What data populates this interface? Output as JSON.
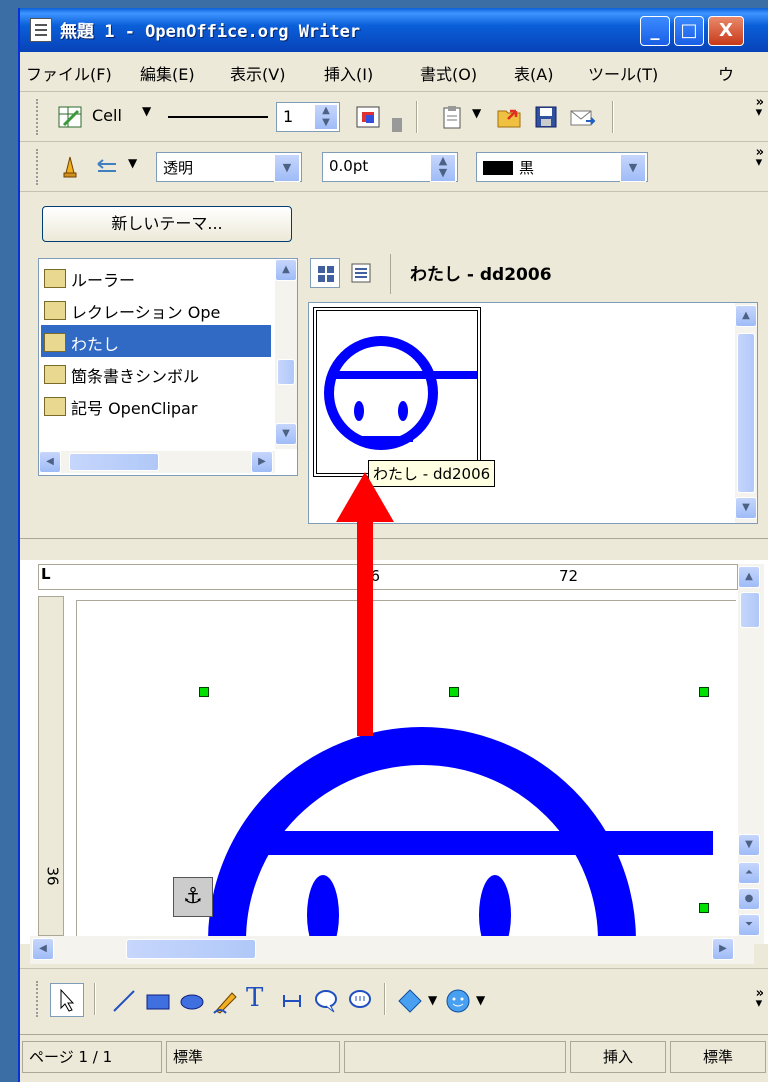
{
  "window": {
    "title": "無題 1 - OpenOffice.org Writer",
    "controls": [
      "_",
      "□",
      "X"
    ]
  },
  "menubar": {
    "items": [
      "ファイル(F)",
      "編集(E)",
      "表示(V)",
      "挿入(I)",
      "書式(O)",
      "表(A)",
      "ツール(T)",
      "ウ"
    ]
  },
  "toolbar1": {
    "cell_label": "Cell",
    "line_width": "1",
    "icons": [
      "table-icon",
      "line-style-icon",
      "color-icon",
      "clipboard-icon",
      "open-folder-icon",
      "save-icon",
      "mail-icon"
    ]
  },
  "toolbar2": {
    "fill_value": "透明",
    "size_value": "0.0pt",
    "color_value": "黒",
    "icons": [
      "pen-icon",
      "arrow-icon"
    ]
  },
  "gallery": {
    "new_theme_button": "新しいテーマ...",
    "themes": [
      {
        "label": "ルーラー",
        "selected": false
      },
      {
        "label": "レクレーション Ope",
        "selected": false
      },
      {
        "label": "わたし",
        "selected": true
      },
      {
        "label": "箇条書きシンボル",
        "selected": false
      },
      {
        "label": "記号 OpenClipar",
        "selected": false
      }
    ],
    "current_theme_title": "わたし - dd2006",
    "tooltip": "わたし - dd2006"
  },
  "rulers": {
    "h_labels": [
      "36",
      "72"
    ],
    "v_label": "36"
  },
  "drawing_toolbar": {
    "icons": [
      "select-icon",
      "line-icon",
      "rectangle-icon",
      "ellipse-icon",
      "freeform-icon",
      "text-icon",
      "dimension-icon",
      "callout-icon",
      "callout-round-icon",
      "diamond-icon",
      "smiley-icon"
    ]
  },
  "statusbar": {
    "page": "ページ 1 / 1",
    "style": "標準",
    "blank": "",
    "mode": "挿入",
    "selection": "標準"
  },
  "colors": {
    "drawing_blue": "#0000ff",
    "arrow_red": "#ff0000",
    "handle_green": "#00e000",
    "selection_blue": "#316ac5"
  }
}
